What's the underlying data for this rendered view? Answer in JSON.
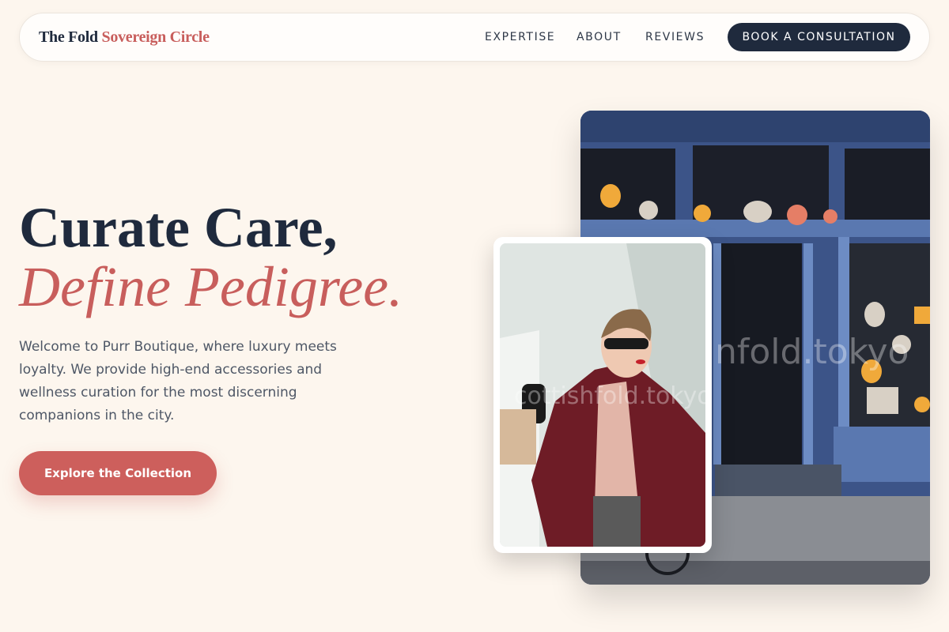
{
  "brand": {
    "part1": "The Fold",
    "part2": "Sovereign Circle"
  },
  "nav": {
    "links": [
      "EXPERTISE",
      "ABOUT",
      "REVIEWS"
    ],
    "cta": "BOOK A CONSULTATION"
  },
  "hero": {
    "title_line1": "Curate Care,",
    "title_line2": "Define Pedigree.",
    "lead": "Welcome to Purr Boutique, where luxury meets loyalty. We provide high-end accessories and wellness curation for the most discerning companions in the city.",
    "button": "Explore the Collection"
  },
  "images": {
    "storefront_watermark": "nfold.tokyo",
    "portrait_watermark": "cottishfold.tokyo"
  },
  "colors": {
    "navy": "#1f2a3d",
    "coral": "#c85e5c",
    "background": "#fdf6ee"
  }
}
